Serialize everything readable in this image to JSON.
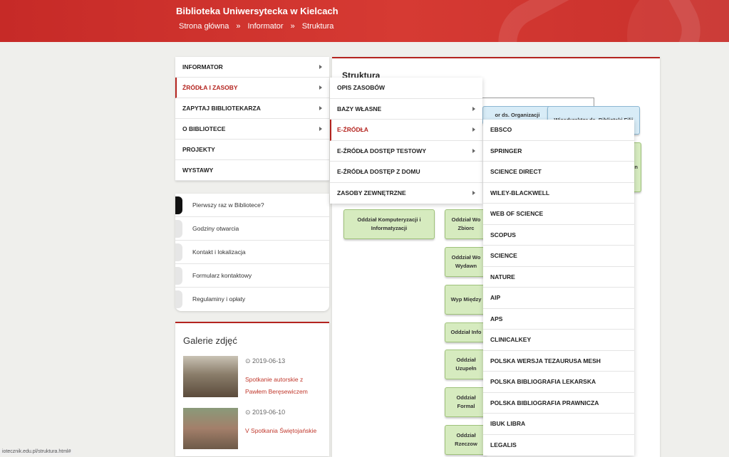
{
  "header": {
    "site_title": "Biblioteka Uniwersytecka w Kielcach",
    "breadcrumb": [
      "Strona główna",
      "Informator",
      "Struktura"
    ],
    "breadcrumb_separator": "»",
    "brand_color": "#c62a27"
  },
  "main_menu": [
    {
      "label": "INFORMATOR",
      "has_submenu": true,
      "active": false
    },
    {
      "label": "ŹRÓDŁA I ZASOBY",
      "has_submenu": true,
      "active": true
    },
    {
      "label": "ZAPYTAJ BIBLIOTEKARZA",
      "has_submenu": true,
      "active": false
    },
    {
      "label": "O BIBLIOTECE",
      "has_submenu": true,
      "active": false
    },
    {
      "label": "PROJEKTY",
      "has_submenu": false,
      "active": false
    },
    {
      "label": "WYSTAWY",
      "has_submenu": false,
      "active": false
    }
  ],
  "quick_links": [
    "Pierwszy raz w Bibliotece?",
    "Godziny otwarcia",
    "Kontakt i lokalizacja",
    "Formularz kontaktowy",
    "Regulaminy i opłaty"
  ],
  "gallery": {
    "title": "Galerie zdjęć",
    "items": [
      {
        "date": "2019-06-13",
        "title": "Spotkanie autorskie z Pawłem Beręsewiczem"
      },
      {
        "date": "2019-06-10",
        "title": "V Spotkania Świętojańskie"
      }
    ]
  },
  "content": {
    "title": "Struktura",
    "org_boxes": [
      "or ds. Organizacji",
      "Wicedyrektor ds. Biblioteki Filii",
      "Oddział Komputeryzacji i Informatyzacji",
      "Oddział Wo Zbiorc",
      "Oddział Wo Wydawn",
      "Wyp Między",
      "Oddział Info",
      "Oddział Uzupełn",
      "Oddział Formal",
      "Oddział Rzeczow",
      "n"
    ]
  },
  "sub_menu": [
    {
      "label": "OPIS ZASOBÓW",
      "has_submenu": false,
      "active": false
    },
    {
      "label": "BAZY WŁASNE",
      "has_submenu": true,
      "active": false
    },
    {
      "label": "E-ŹRÓDŁA",
      "has_submenu": true,
      "active": true
    },
    {
      "label": "E-ŹRÓDŁA DOSTĘP TESTOWY",
      "has_submenu": true,
      "active": false
    },
    {
      "label": "E-ŹRÓDŁA DOSTĘP Z DOMU",
      "has_submenu": false,
      "active": false
    },
    {
      "label": "ZASOBY ZEWNĘTRZNE",
      "has_submenu": true,
      "active": false
    }
  ],
  "e_sources_menu": [
    "EBSCO",
    "SPRINGER",
    "SCIENCE DIRECT",
    "WILEY-BLACKWELL",
    "WEB OF SCIENCE",
    "SCOPUS",
    "SCIENCE",
    "NATURE",
    "AIP",
    "APS",
    "CLINICALKEY",
    "POLSKA WERSJA TEZAURUSA MESH",
    "POLSKA BIBLIOGRAFIA LEKARSKA",
    "POLSKA BIBLIOGRAFIA PRAWNICZA",
    "IBUK LIBRA",
    "LEGALIS"
  ],
  "status_bar": {
    "url": "iotecznik.edu.pl/struktura.html#"
  },
  "colors": {
    "accent": "#b4241f",
    "org_green": "#d6ebbf",
    "org_blue": "#d8ecf7"
  }
}
